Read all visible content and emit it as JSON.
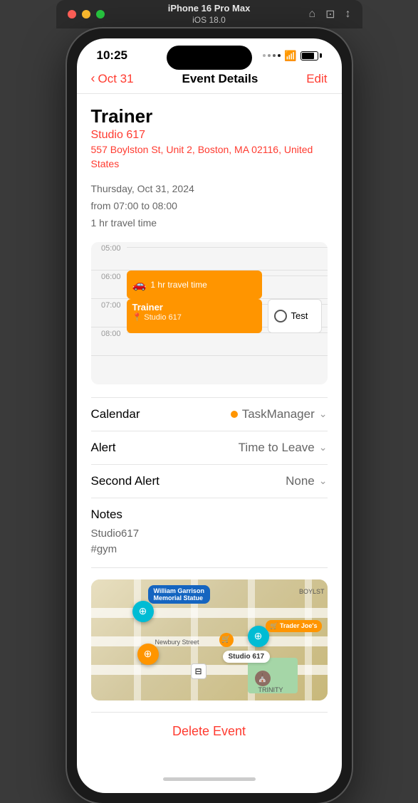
{
  "macBar": {
    "model": "iPhone 16 Pro Max",
    "os": "iOS 18.0"
  },
  "statusBar": {
    "time": "10:25",
    "dots": [
      "",
      "",
      "",
      ""
    ],
    "wifi": "wifi",
    "battery": 85
  },
  "nav": {
    "backLabel": "Oct 31",
    "title": "Event Details",
    "editLabel": "Edit"
  },
  "event": {
    "title": "Trainer",
    "studio": "Studio 617",
    "address": "557 Boylston St, Unit 2, Boston, MA 02116, United States",
    "date": "Thursday, Oct 31, 2024",
    "timeRange": "from 07:00 to 08:00",
    "travelTime": "1 hr travel time"
  },
  "timeline": {
    "times": [
      "05:00",
      "06:00",
      "07:00",
      "08:00"
    ],
    "travelBlock": {
      "icon": "🚗",
      "label": "1 hr travel time"
    },
    "trainerBlock": {
      "title": "Trainer",
      "location": "📍 Studio 617"
    },
    "testBlock": {
      "label": "Test"
    }
  },
  "details": {
    "calendar": {
      "label": "Calendar",
      "value": "TaskManager",
      "dotColor": "#ff9500"
    },
    "alert": {
      "label": "Alert",
      "value": "Time to Leave"
    },
    "secondAlert": {
      "label": "Second Alert",
      "value": "None"
    }
  },
  "notes": {
    "label": "Notes",
    "text": "Studio617\n#gym"
  },
  "map": {
    "labels": [
      "William Garrison Memorial Statue",
      "Newbury Street",
      "Studio 617",
      "Trader Joe's",
      "BOYLST",
      "TRINITY"
    ]
  },
  "deleteButton": "Delete Event",
  "icons": {
    "chevronLeft": "‹",
    "chevronDown": "⌄",
    "car": "🚗",
    "pin": "📍"
  }
}
